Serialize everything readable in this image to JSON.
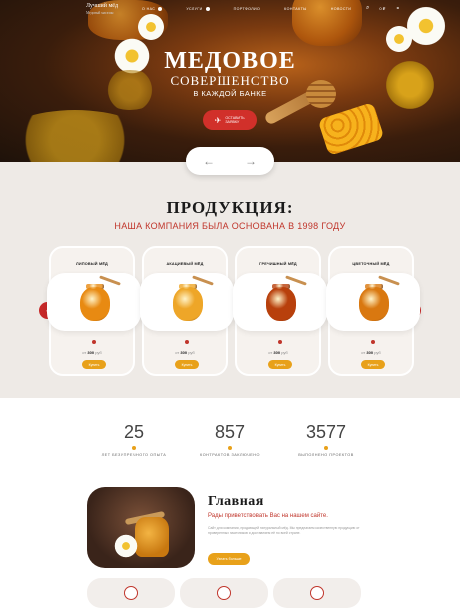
{
  "nav": {
    "logo_title": "Лучший мёд",
    "logo_subtitle": "Медовый магазин",
    "links": [
      "О НАС",
      "УСЛУГИ",
      "ПОРТФОЛИО",
      "КОНТАКТЫ",
      "НОВОСТИ"
    ],
    "cart_label": "0 ₽",
    "icons": [
      "search-icon",
      "cart-icon",
      "user-icon"
    ]
  },
  "hero": {
    "title": "МЕДОВОЕ",
    "subtitle": "СОВЕРШЕНСТВО",
    "tagline": "В КАЖДОЙ БАНКЕ",
    "cta_label": "ОСТАВИТЬ ЗАЯВКУ"
  },
  "slider": {
    "prev_icon": "←",
    "next_icon": "→"
  },
  "products": {
    "title": "ПРОДУКЦИЯ:",
    "subtitle": "НАША КОМПАНИЯ БЫЛА ОСНОВАНА В 1998 ГОДУ",
    "prev_icon": "‹",
    "next_icon": "›",
    "items": [
      {
        "name": "ЛИПОВЫЙ МЁД",
        "price_prefix": "от",
        "price": "300",
        "price_unit": "руб",
        "button": "Купить",
        "jar_color": "#e88a12"
      },
      {
        "name": "АКАЦИЕВЫЙ МЁД",
        "price_prefix": "от",
        "price": "300",
        "price_unit": "руб",
        "button": "Купить",
        "jar_color": "#eea628"
      },
      {
        "name": "ГРЕЧИШНЫЙ МЁД",
        "price_prefix": "от",
        "price": "300",
        "price_unit": "руб",
        "button": "Купить",
        "jar_color": "#b8400c"
      },
      {
        "name": "ЦВЕТОЧНЫЙ МЁД",
        "price_prefix": "от",
        "price": "300",
        "price_unit": "руб",
        "button": "Купить",
        "jar_color": "#d97810"
      }
    ]
  },
  "stats": [
    {
      "value": "25",
      "label": "ЛЕТ БЕЗУПРЕЧНОГО ОПЫТА"
    },
    {
      "value": "857",
      "label": "КОНТРАКТОВ ЗАКЛЮЧЕНО"
    },
    {
      "value": "3577",
      "label": "ВЫПОЛНЕНО ПРОЕКТОВ"
    }
  ],
  "about": {
    "title": "Главная",
    "subtitle": "Рады приветствовать Вас на нашем сайте.",
    "text": "Сайт для компании, продающей натуральный мёд. Мы предлагаем качественную продукцию от проверенных пасечников и доставляем её по всей стране.",
    "button": "Узнать больше"
  },
  "features": [
    "feature-icon-1",
    "feature-icon-2",
    "feature-icon-3"
  ]
}
